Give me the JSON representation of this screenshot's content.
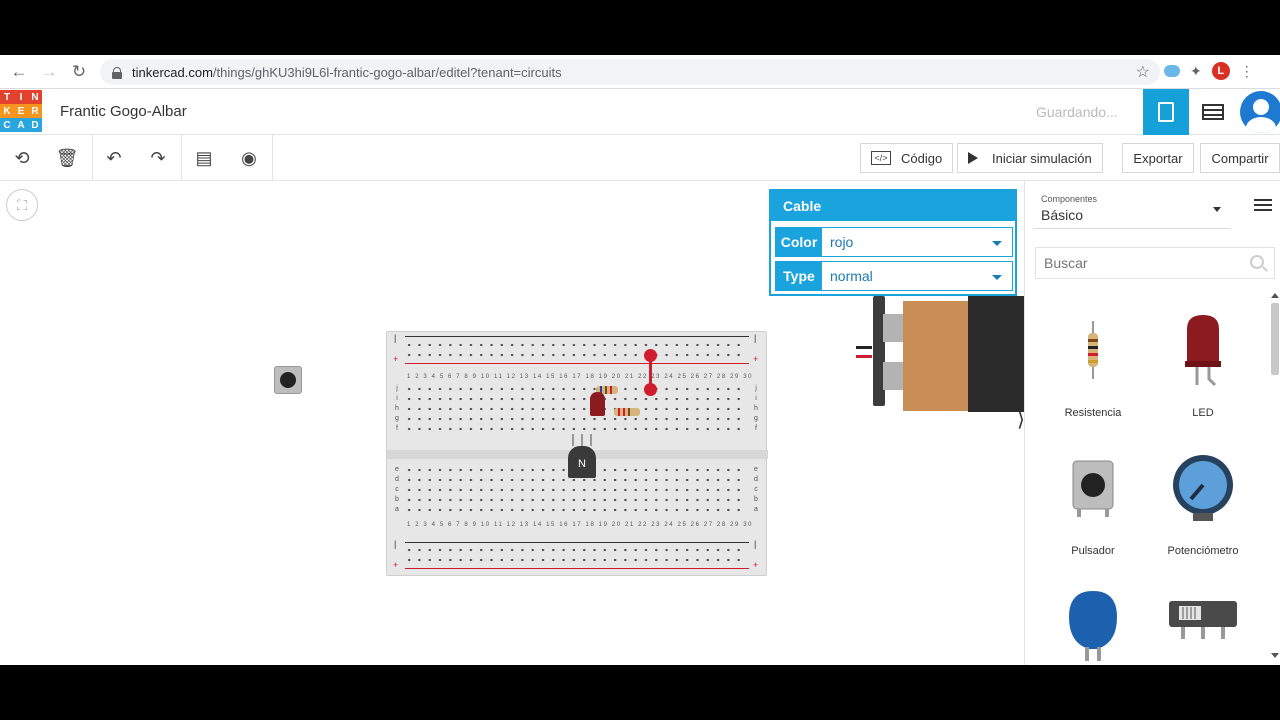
{
  "browser": {
    "url_domain": "tinkercad.com",
    "url_path": "/things/ghKU3hi9L6l-frantic-gogo-albar/editel?tenant=circuits",
    "profile_initial": "L"
  },
  "header": {
    "logo_letters": [
      "T",
      "I",
      "N",
      "K",
      "E",
      "R",
      "C",
      "A",
      "D"
    ],
    "logo_colors": [
      "#e2412e",
      "#e2412e",
      "#e2412e",
      "#f7941d",
      "#f7941d",
      "#f7941d",
      "#2aa6df",
      "#2aa6df",
      "#2aa6df"
    ],
    "project_title": "Frantic Gogo-Albar",
    "status": "Guardando..."
  },
  "toolbar": {
    "code_label": "Código",
    "simulate_label": "Iniciar simulación",
    "export_label": "Exportar",
    "share_label": "Compartir"
  },
  "cable_panel": {
    "title": "Cable",
    "color_label": "Color",
    "color_value": "rojo",
    "type_label": "Type",
    "type_value": "normal"
  },
  "components_panel": {
    "select_label": "Componentes",
    "select_value": "Básico",
    "search_placeholder": "Buscar",
    "items": [
      {
        "label": "Resistencia"
      },
      {
        "label": "LED"
      },
      {
        "label": "Pulsador"
      },
      {
        "label": "Potenciómetro"
      },
      {
        "label": ""
      },
      {
        "label": ""
      }
    ]
  },
  "breadboard": {
    "transistor_label": "N",
    "col_numbers": "1  2  3  4  5  6  7  8  9 10 11 12 13 14 15 16 17 18 19 20 21 22 23 24 25 26 27 28 29 30",
    "rows_top": [
      "j",
      "i",
      "h",
      "g",
      "f"
    ],
    "rows_bottom": [
      "e",
      "d",
      "c",
      "b",
      "a"
    ]
  },
  "colors": {
    "accent": "#1aa3dc",
    "wire_red": "#d01c2e",
    "canvas": "#ffffff"
  }
}
